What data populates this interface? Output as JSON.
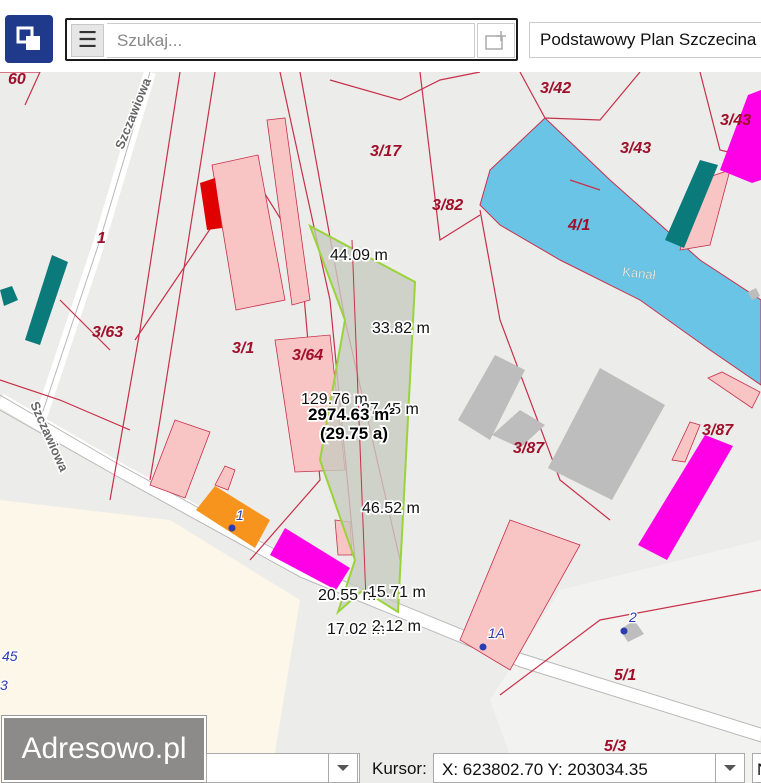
{
  "search": {
    "placeholder": "Szukaj..."
  },
  "plan_select": {
    "value": "Podstawowy Plan Szczecina"
  },
  "brand": {
    "label": "Adresowo.pl"
  },
  "cursor": {
    "label": "Kursor:",
    "value": "X: 623802.70  Y: 203034.35",
    "cut_value": "N"
  },
  "map": {
    "parcel_labels": [
      "60",
      "3/42",
      "3/43",
      "3/17",
      "3/43",
      "3/82",
      "4/1",
      "1",
      "3/63",
      "3/1",
      "3/64",
      "3/87",
      "3/87",
      "1",
      "1A",
      "2",
      "5/1",
      "5/3",
      "45",
      "3"
    ],
    "street_labels": [
      "Szczawiowa",
      "Szczawiowa"
    ],
    "water_label": "Kanał",
    "measure_labels": [
      "44.09 m",
      "33.82 m",
      "129.76 m",
      "27.45 m",
      "46.52 m",
      "20.55 m",
      "15.71 m",
      "17.02 m",
      "2.12 m"
    ],
    "area_label": "2974.63 m²",
    "area_ares_label": "(29.75 a)"
  },
  "colors": {
    "app_button": "#1f3a8a",
    "parcel_line": "#c8304a",
    "building_pink": "#f9c4c4",
    "building_magenta": "#ff00e6",
    "building_teal": "#0b7a7a",
    "building_gray": "#bdbdbd",
    "water": "#6ac4e6",
    "measured_parcel": "#c8ccc0",
    "measured_outline": "#9ad33a"
  }
}
